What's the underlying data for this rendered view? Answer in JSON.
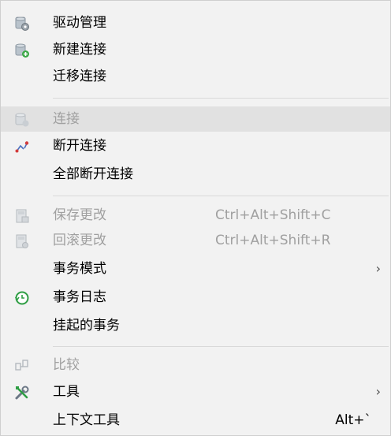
{
  "menu": {
    "items": [
      {
        "label": "驱动管理",
        "icon": "driver-gear-icon",
        "disabled": false
      },
      {
        "label": "新建连接",
        "icon": "new-connection-database-icon",
        "disabled": false
      },
      {
        "label": "迁移连接",
        "icon": "",
        "disabled": false
      },
      {
        "label": "连接",
        "icon": "connect-database-icon",
        "disabled": true
      },
      {
        "label": "断开连接",
        "icon": "disconnect-icon",
        "disabled": false
      },
      {
        "label": "全部断开连接",
        "icon": "",
        "disabled": false
      },
      {
        "label": "保存更改",
        "shortcut": "Ctrl+Alt+Shift+C",
        "icon": "save-changes-icon",
        "disabled": true
      },
      {
        "label": "回滚更改",
        "shortcut": "Ctrl+Alt+Shift+R",
        "icon": "rollback-changes-icon",
        "disabled": true
      },
      {
        "label": "事务模式",
        "submenu": "›",
        "icon": "",
        "disabled": false
      },
      {
        "label": "事务日志",
        "icon": "transaction-log-clock-icon",
        "disabled": false
      },
      {
        "label": "挂起的事务",
        "icon": "",
        "disabled": false
      },
      {
        "label": "比较",
        "icon": "compare-icon",
        "disabled": true
      },
      {
        "label": "工具",
        "submenu": "›",
        "icon": "tools-wrench-icon",
        "disabled": false
      },
      {
        "label": "上下文工具",
        "shortcut": "Alt+`",
        "icon": "",
        "disabled": false
      }
    ]
  }
}
